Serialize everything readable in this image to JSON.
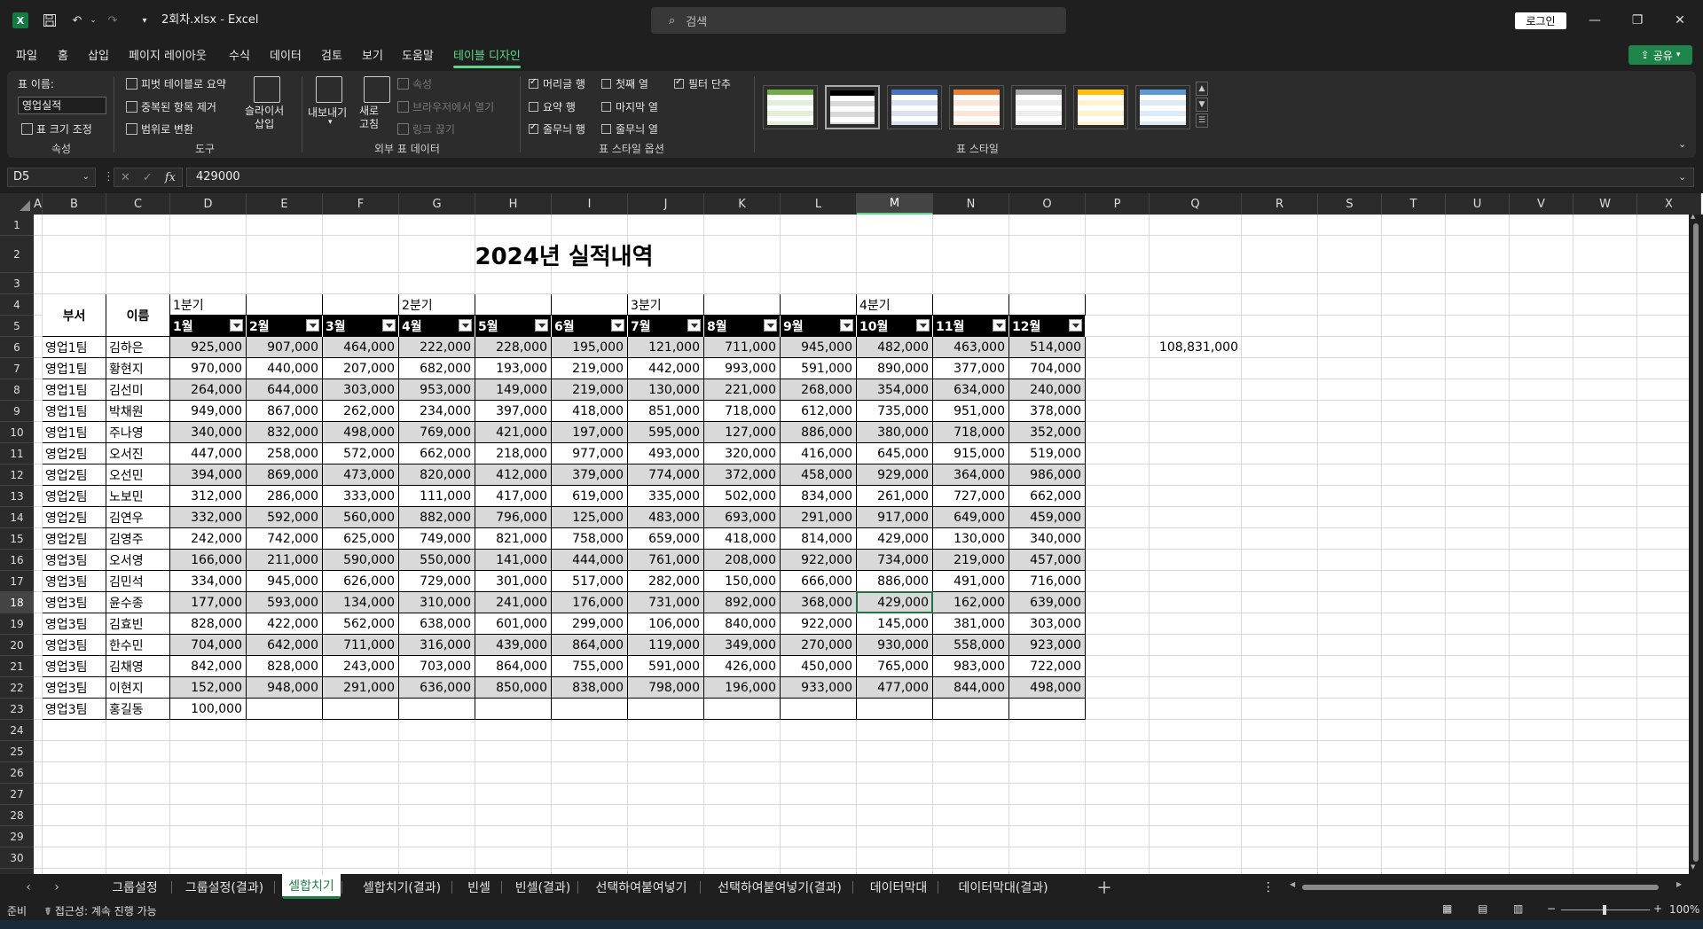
{
  "app": {
    "doc_title": "2회차.xlsx  -  Excel",
    "search_placeholder": "검색",
    "login": "로그인",
    "share": "공유",
    "logo": "X"
  },
  "menu": [
    "파일",
    "홈",
    "삽입",
    "페이지 레이아웃",
    "수식",
    "데이터",
    "검토",
    "보기",
    "도움말",
    "테이블 디자인"
  ],
  "ribbon": {
    "props": {
      "table_name_label": "표 이름:",
      "table_name": "영업실적",
      "resize": "표 크기 조정",
      "group": "속성"
    },
    "tools": {
      "pivot": "피벗 테이블로 요약",
      "dedupe": "중복된 항목 제거",
      "convert": "범위로 변환",
      "slicer": "슬라이서\n삽입",
      "group": "도구"
    },
    "external": {
      "export": "내보내기",
      "refresh": "새로\n고침",
      "props": "속성",
      "browser": "브라우저에서 열기",
      "unlink": "링크 끊기",
      "group": "외부 표 데이터"
    },
    "options": {
      "header_row": "머리글 행",
      "first_col": "첫째 열",
      "filter_btn": "필터 단추",
      "total_row": "요약 행",
      "last_col": "마지막 열",
      "banded_rows": "줄무늬 행",
      "banded_cols": "줄무늬 열",
      "group": "표 스타일 옵션"
    },
    "styles_group": "표 스타일",
    "swatches": [
      {
        "c0": "#70ad47",
        "c1": "#e2efda",
        "c2": "#ffffff"
      },
      {
        "c0": "#000000",
        "c1": "#d9d9d9",
        "c2": "#ffffff"
      },
      {
        "c0": "#4472c4",
        "c1": "#d9e1f2",
        "c2": "#ffffff"
      },
      {
        "c0": "#ed7d31",
        "c1": "#fce4d6",
        "c2": "#ffffff"
      },
      {
        "c0": "#a5a5a5",
        "c1": "#ededed",
        "c2": "#ffffff"
      },
      {
        "c0": "#ffc000",
        "c1": "#fff2cc",
        "c2": "#ffffff"
      },
      {
        "c0": "#5b9bd5",
        "c1": "#ddebf7",
        "c2": "#ffffff"
      }
    ]
  },
  "formula": {
    "name_box": "D5",
    "value": "429000"
  },
  "columns": [
    "A",
    "B",
    "C",
    "D",
    "E",
    "F",
    "G",
    "H",
    "I",
    "J",
    "K",
    "L",
    "M",
    "N",
    "O",
    "P",
    "Q",
    "R",
    "S",
    "T",
    "U",
    "V",
    "W",
    "X"
  ],
  "sheet": {
    "title": "2024년 실적내역",
    "dept_header": "부서",
    "name_header": "이름",
    "quarters": [
      "1분기",
      "2분기",
      "3분기",
      "4분기"
    ],
    "months": [
      "1월",
      "2월",
      "3월",
      "4월",
      "5월",
      "6월",
      "7월",
      "8월",
      "9월",
      "10월",
      "11월",
      "12월"
    ],
    "side_value": "108,831,000",
    "rows": [
      [
        "영업1팀",
        "김하은",
        "925,000",
        "907,000",
        "464,000",
        "222,000",
        "228,000",
        "195,000",
        "121,000",
        "711,000",
        "945,000",
        "482,000",
        "463,000",
        "514,000"
      ],
      [
        "영업1팀",
        "황현지",
        "970,000",
        "440,000",
        "207,000",
        "682,000",
        "193,000",
        "219,000",
        "442,000",
        "993,000",
        "591,000",
        "890,000",
        "377,000",
        "704,000"
      ],
      [
        "영업1팀",
        "김선미",
        "264,000",
        "644,000",
        "303,000",
        "953,000",
        "149,000",
        "219,000",
        "130,000",
        "221,000",
        "268,000",
        "354,000",
        "634,000",
        "240,000"
      ],
      [
        "영업1팀",
        "박채원",
        "949,000",
        "867,000",
        "262,000",
        "234,000",
        "397,000",
        "418,000",
        "851,000",
        "718,000",
        "612,000",
        "735,000",
        "951,000",
        "378,000"
      ],
      [
        "영업1팀",
        "주나영",
        "340,000",
        "832,000",
        "498,000",
        "769,000",
        "421,000",
        "197,000",
        "595,000",
        "127,000",
        "886,000",
        "380,000",
        "718,000",
        "352,000"
      ],
      [
        "영업2팀",
        "오서진",
        "447,000",
        "258,000",
        "572,000",
        "662,000",
        "218,000",
        "977,000",
        "493,000",
        "320,000",
        "416,000",
        "645,000",
        "915,000",
        "519,000"
      ],
      [
        "영업2팀",
        "오선민",
        "394,000",
        "869,000",
        "473,000",
        "820,000",
        "412,000",
        "379,000",
        "774,000",
        "372,000",
        "458,000",
        "929,000",
        "364,000",
        "986,000"
      ],
      [
        "영업2팀",
        "노보민",
        "312,000",
        "286,000",
        "333,000",
        "111,000",
        "417,000",
        "619,000",
        "335,000",
        "502,000",
        "834,000",
        "261,000",
        "727,000",
        "662,000"
      ],
      [
        "영업2팀",
        "김연우",
        "332,000",
        "592,000",
        "560,000",
        "882,000",
        "796,000",
        "125,000",
        "483,000",
        "693,000",
        "291,000",
        "917,000",
        "649,000",
        "459,000"
      ],
      [
        "영업2팀",
        "김영주",
        "242,000",
        "742,000",
        "625,000",
        "749,000",
        "821,000",
        "758,000",
        "659,000",
        "418,000",
        "814,000",
        "429,000",
        "130,000",
        "340,000"
      ],
      [
        "영업3팀",
        "오서영",
        "166,000",
        "211,000",
        "590,000",
        "550,000",
        "141,000",
        "444,000",
        "761,000",
        "208,000",
        "922,000",
        "734,000",
        "219,000",
        "457,000"
      ],
      [
        "영업3팀",
        "김민석",
        "334,000",
        "945,000",
        "626,000",
        "729,000",
        "301,000",
        "517,000",
        "282,000",
        "150,000",
        "666,000",
        "886,000",
        "491,000",
        "716,000"
      ],
      [
        "영업3팀",
        "윤수종",
        "177,000",
        "593,000",
        "134,000",
        "310,000",
        "241,000",
        "176,000",
        "731,000",
        "892,000",
        "368,000",
        "429,000",
        "162,000",
        "639,000"
      ],
      [
        "영업3팀",
        "김효빈",
        "828,000",
        "422,000",
        "562,000",
        "638,000",
        "601,000",
        "299,000",
        "106,000",
        "840,000",
        "922,000",
        "145,000",
        "381,000",
        "303,000"
      ],
      [
        "영업3팀",
        "한수민",
        "704,000",
        "642,000",
        "711,000",
        "316,000",
        "439,000",
        "864,000",
        "119,000",
        "349,000",
        "270,000",
        "930,000",
        "558,000",
        "923,000"
      ],
      [
        "영업3팀",
        "김채영",
        "842,000",
        "828,000",
        "243,000",
        "703,000",
        "864,000",
        "755,000",
        "591,000",
        "426,000",
        "450,000",
        "765,000",
        "983,000",
        "722,000"
      ],
      [
        "영업3팀",
        "이현지",
        "152,000",
        "948,000",
        "291,000",
        "636,000",
        "850,000",
        "838,000",
        "798,000",
        "196,000",
        "933,000",
        "477,000",
        "844,000",
        "498,000"
      ],
      [
        "영업3팀",
        "홍길동",
        "100,000",
        "",
        "",
        "",
        "",
        "",
        "",
        "",
        "",
        "",
        "",
        ""
      ]
    ]
  },
  "tabs": [
    "그룹설정",
    "그룹설정(결과)",
    "셀합치기",
    "셀합치기(결과)",
    "빈셀",
    "빈셀(결과)",
    "선택하여붙여넣기",
    "선택하여붙여넣기(결과)",
    "데이터막대",
    "데이터막대(결과)"
  ],
  "status": {
    "ready": "준비",
    "accessibility": "접근성: 계속 진행 가능",
    "zoom": "100%"
  }
}
